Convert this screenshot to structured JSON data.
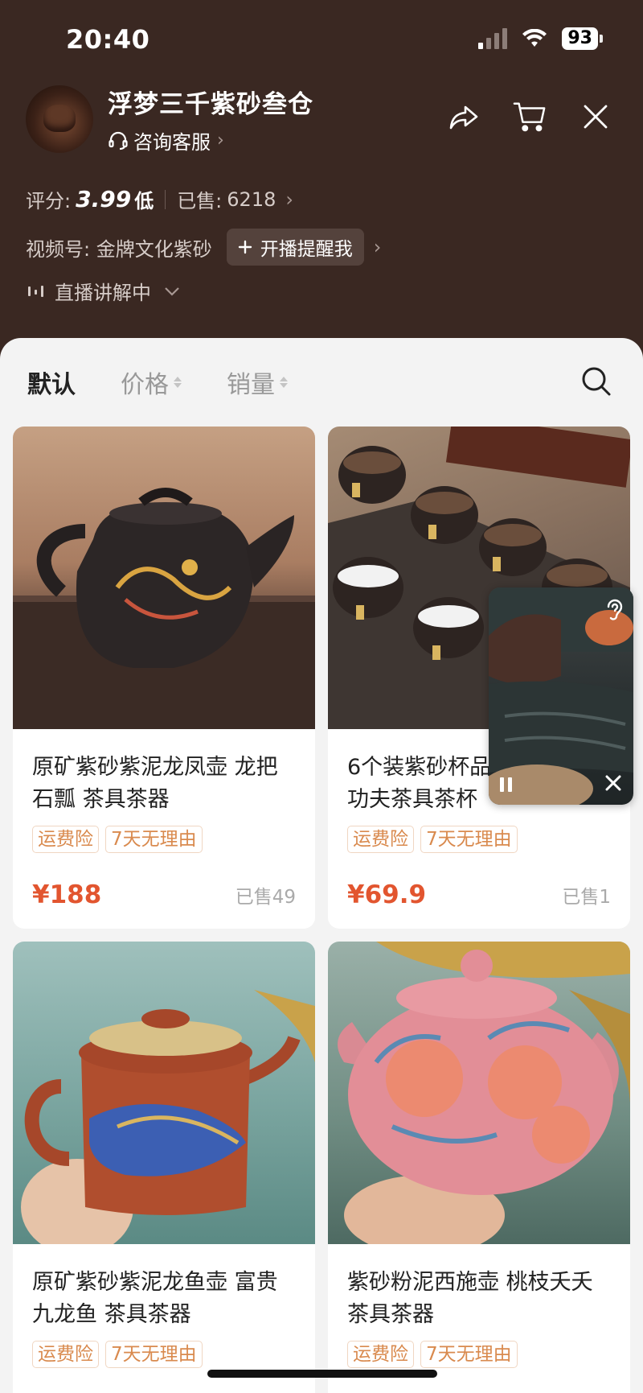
{
  "status_bar": {
    "time": "20:40",
    "battery": "93"
  },
  "shop": {
    "name": "浮梦三千紫砂叁仓",
    "service_label": "咨询客服"
  },
  "stats": {
    "score_label": "评分:",
    "score_value": "3.99",
    "score_level": "低",
    "sold_label": "已售:",
    "sold_value": "6218"
  },
  "channel": {
    "label": "视频号: 金牌文化紫砂",
    "remind_label": "开播提醒我"
  },
  "live": {
    "label": "直播讲解中"
  },
  "sort": {
    "default_label": "默认",
    "price_label": "价格",
    "sales_label": "销量"
  },
  "products": [
    {
      "title": "原矿紫砂紫泥龙凤壶 龙把石瓢 茶具茶器",
      "tags": [
        "运费险",
        "7天无理由"
      ],
      "price": "¥188",
      "sold": "已售49"
    },
    {
      "title": "6个装紫砂杯品茗杯 小茶杯功夫茶具茶杯",
      "tags": [
        "运费险",
        "7天无理由"
      ],
      "price": "¥69.9",
      "sold": "已售1"
    },
    {
      "title": "原矿紫砂紫泥龙鱼壶 富贵九龙鱼 茶具茶器",
      "tags": [
        "运费险",
        "7天无理由"
      ],
      "price": "",
      "sold": ""
    },
    {
      "title": "紫砂粉泥西施壶 桃枝夭夭茶具茶器",
      "tags": [
        "运费险",
        "7天无理由"
      ],
      "price": "",
      "sold": ""
    }
  ],
  "colors": {
    "header_bg": "#3a2822",
    "price": "#e2552f",
    "tag": "#d98a4e"
  }
}
